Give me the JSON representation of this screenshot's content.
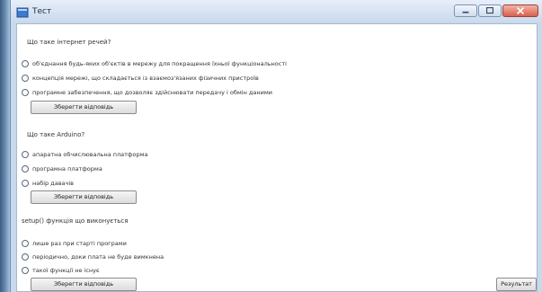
{
  "window": {
    "title": "Тест"
  },
  "questions": [
    {
      "text": "Що таке інтернет речей?",
      "options": [
        "об'єднання будь-яких об'єктів в мережу для покращення їхньої функціональності",
        "концепція мережі, що складається із взаємоз'язаних фізичних пристроїв",
        "програмне забезпечення, що дозволяє здійснювати передачу і обмін даними"
      ],
      "button_label": "Зберегти відповідь"
    },
    {
      "text": "Що таке Arduino?",
      "options": [
        "апаратна обчислювальна платформа",
        "програмна платформа",
        "набір давачів"
      ],
      "button_label": "Зберегти відповідь"
    },
    {
      "text": "setup() функція що виконується",
      "options": [
        "лише раз при старті програми",
        "періодично, доки плата не буде вимкнена",
        "такої функції не існує"
      ],
      "button_label": "Зберегти відповідь"
    }
  ],
  "result_button_label": "Результат"
}
